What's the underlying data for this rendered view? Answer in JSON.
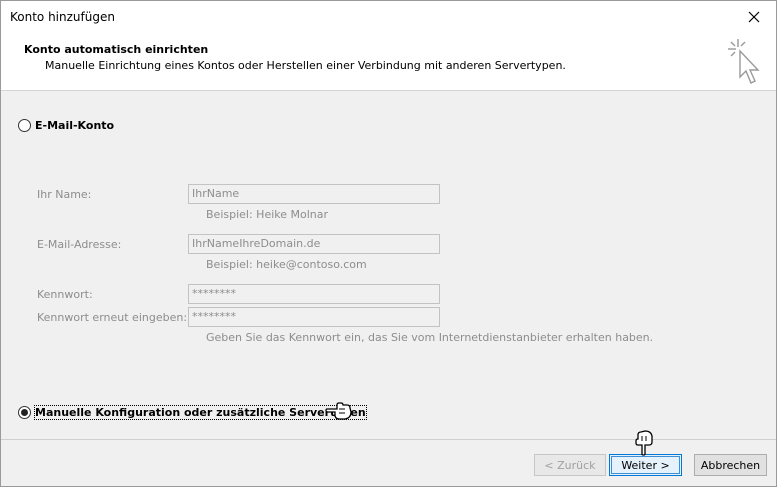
{
  "window": {
    "title": "Konto hinzufügen"
  },
  "header": {
    "title": "Konto automatisch einrichten",
    "subtitle": "Manuelle Einrichtung eines Kontos oder Herstellen einer Verbindung mit anderen Servertypen."
  },
  "options": {
    "email_account": {
      "label": "E-Mail-Konto",
      "selected": false
    },
    "manual_config": {
      "label": "Manuelle Konfiguration oder zusätzliche Servertypen",
      "selected": true
    }
  },
  "form": {
    "name": {
      "label": "Ihr Name:",
      "value": "IhrName",
      "hint": "Beispiel: Heike Molnar"
    },
    "email": {
      "label": "E-Mail-Adresse:",
      "value": "IhrNameIhreDomain.de",
      "hint": "Beispiel: heike@contoso.com"
    },
    "password": {
      "label": "Kennwort:",
      "value": "********"
    },
    "password_repeat": {
      "label": "Kennwort erneut eingeben:",
      "value": "********"
    },
    "password_hint": "Geben Sie das Kennwort ein, das Sie vom Internetdienstanbieter erhalten haben."
  },
  "buttons": {
    "back": "< Zurück",
    "next": "Weiter >",
    "cancel": "Abbrechen"
  }
}
